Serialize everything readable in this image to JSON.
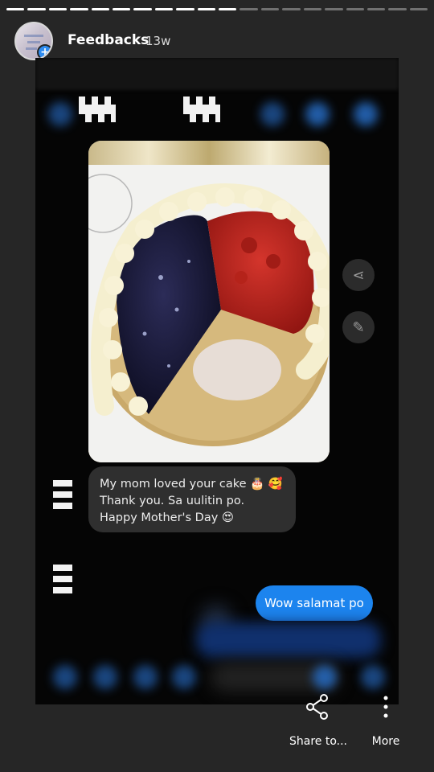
{
  "story": {
    "username": "Feedbacks",
    "time_ago": "13w",
    "progress_segments_total": 20,
    "progress_segments_done": 11
  },
  "chat": {
    "incoming_message_lines": [
      "My mom loved your cake 🎂 🥰",
      "Thank you. Sa uulitin po.",
      "Happy Mother's Day 😍"
    ],
    "outgoing_message": "Wow salamat po",
    "photo_description_icon": "cake-photo",
    "colors": {
      "incoming_bubble": "#2f2f2f",
      "outgoing_bubble": "#1c84ee"
    }
  },
  "actions": {
    "share_label": "Share to...",
    "more_label": "More"
  },
  "icons": {
    "share": "share-icon",
    "more": "more-vertical-icon",
    "side_share": "share-icon",
    "side_edit": "pencil-icon"
  }
}
